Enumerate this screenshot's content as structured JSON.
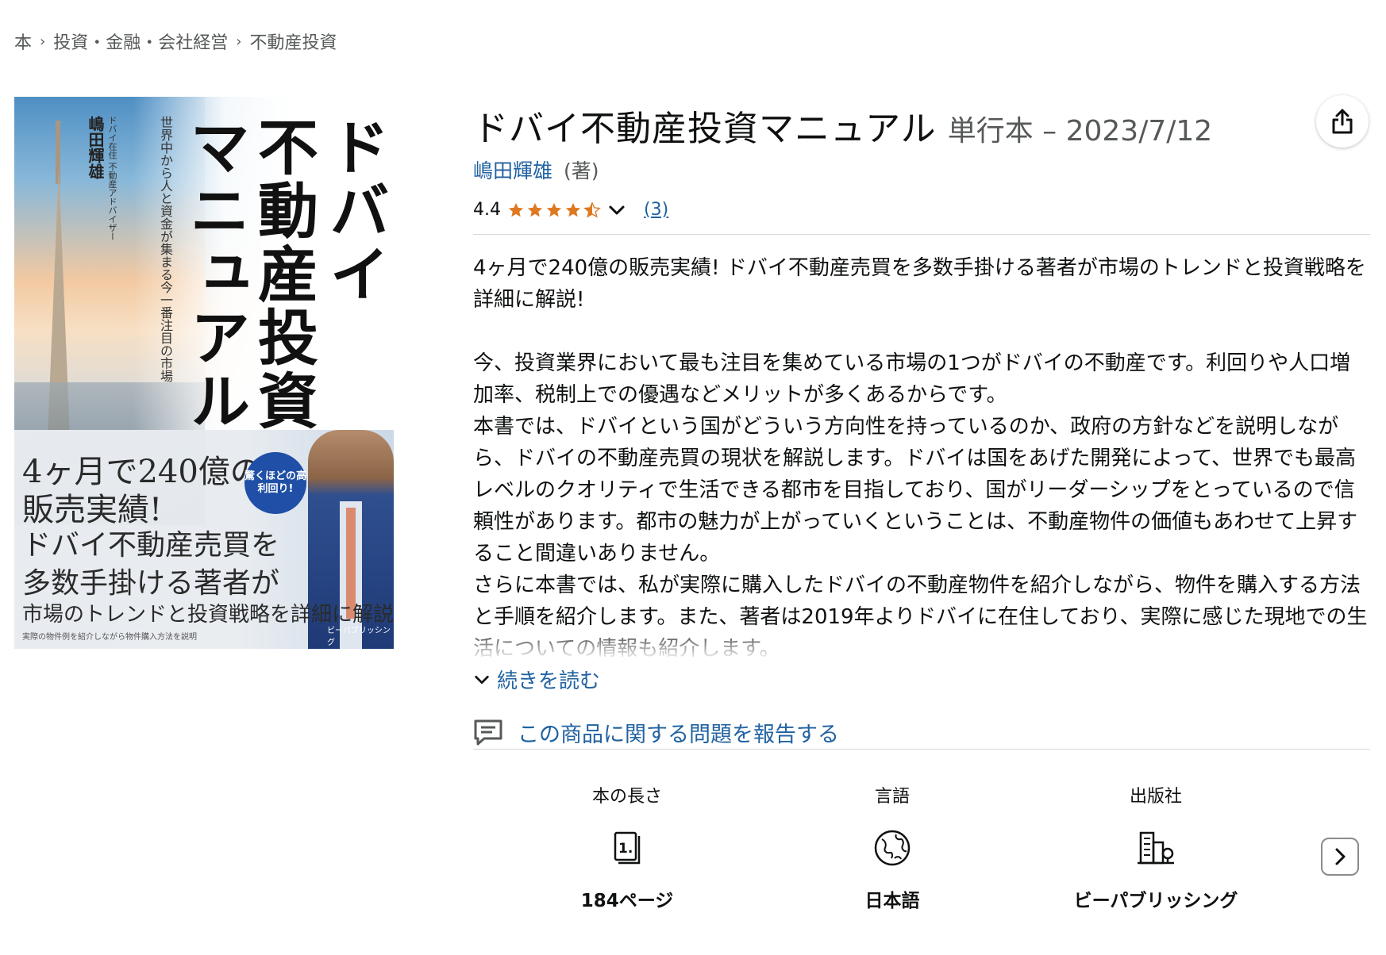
{
  "breadcrumb": {
    "items": [
      "本",
      "投資・金融・会社経営",
      "不動産投資"
    ]
  },
  "cover": {
    "title_col1": "ドバイ",
    "title_col2": "不動産投資",
    "title_col3": "マニュアル",
    "subtitle": "世界中から人と資金が集まる今一番注目の市場",
    "author": "嶋田輝雄",
    "author_role": "ドバイ在住 不動産アドバイザー",
    "blurb1": "4ヶ月で240億の",
    "blurb2": "販売実績!",
    "blurb3": "ドバイ不動産売買を",
    "blurb4": "多数手掛ける著者が",
    "blurb5": "市場のトレンドと投資戦略を詳細に解説!",
    "blurb6": "実際の物件例を紹介しながら物件購入方法を説明",
    "badge": "驚くほどの高利回り!",
    "publisher": "ビーパブリッシング"
  },
  "product": {
    "title": "ドバイ不動産投資マニュアル",
    "format": "単行本 – 2023/7/12",
    "author": "嶋田輝雄",
    "author_role": "(著)",
    "rating": "4.4",
    "rating_fraction": 0.88,
    "review_count": "(3)"
  },
  "description": {
    "p1": "4ヶ月で240億の販売実績! ドバイ不動産売買を多数手掛ける著者が市場のトレンドと投資戦略を詳細に解説!",
    "p2": "今、投資業界において最も注目を集めている市場の1つがドバイの不動産です。利回りや人口増加率、税制上での優遇などメリットが多くあるからです。",
    "p3": "本書では、ドバイという国がどういう方向性を持っているのか、政府の方針などを説明しながら、ドバイの不動産売買の現状を解説します。ドバイは国をあげた開発によって、世界でも最高レベルのクオリティで生活できる都市を目指しており、国がリーダーシップをとっているので信頼性があります。都市の魅力が上がっていくということは、不動産物件の価値もあわせて上昇すること間違いありません。",
    "p4": "さらに本書では、私が実際に購入したドバイの不動産物件を紹介しながら、物件を購入する方法と手順を紹介します。また、著者は2019年よりドバイに在住しており、実際に感じた現地での生活についての情報も紹介します。",
    "read_more": "続きを読む"
  },
  "report_link": "この商品に関する問題を報告する",
  "details": [
    {
      "label": "本の長さ",
      "value": "184ページ",
      "icon": "book-pages-icon"
    },
    {
      "label": "言語",
      "value": "日本語",
      "icon": "globe-icon"
    },
    {
      "label": "出版社",
      "value": "ビーパブリッシング",
      "icon": "building-icon"
    }
  ],
  "colors": {
    "link": "#2162a1",
    "star": "#de7921",
    "text": "#0f1111",
    "muted": "#565959"
  }
}
